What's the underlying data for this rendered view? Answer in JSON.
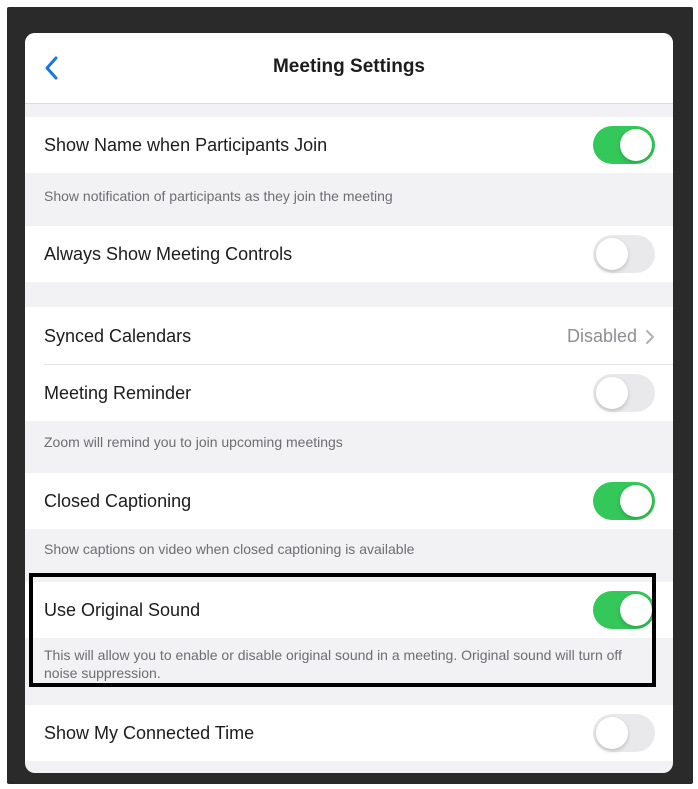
{
  "header": {
    "title": "Meeting Settings",
    "back_icon": "chevron-left-icon"
  },
  "settings": {
    "show_name": {
      "label": "Show Name when Participants Join",
      "enabled": true,
      "description": "Show notification of participants as they join the meeting"
    },
    "always_show_controls": {
      "label": "Always Show Meeting Controls",
      "enabled": false
    },
    "synced_calendars": {
      "label": "Synced Calendars",
      "value": "Disabled",
      "chevron_icon": "chevron-right-icon"
    },
    "meeting_reminder": {
      "label": "Meeting Reminder",
      "enabled": false,
      "description": "Zoom will remind you to join upcoming meetings"
    },
    "closed_captioning": {
      "label": "Closed Captioning",
      "enabled": true,
      "description": "Show captions on video when closed captioning is available"
    },
    "original_sound": {
      "label": "Use Original Sound",
      "enabled": true,
      "description": "This will allow you to enable or disable original sound in a meeting. Original sound will turn off noise suppression."
    },
    "connected_time": {
      "label": "Show My Connected Time",
      "enabled": false
    }
  },
  "colors": {
    "accent_blue": "#1a73e8",
    "toggle_on": "#34c759",
    "toggle_off": "#e9e9eb",
    "grouped_background": "#f2f2f4"
  }
}
